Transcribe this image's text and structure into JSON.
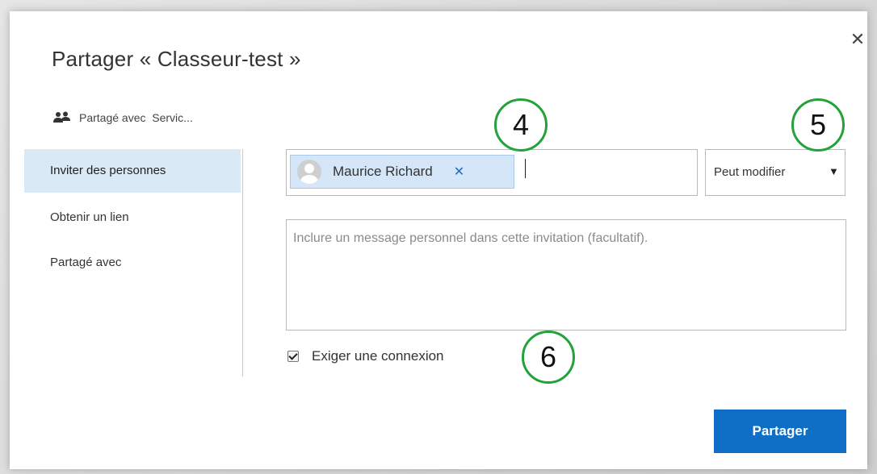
{
  "dialog": {
    "title": "Partager « Classeur-test »",
    "close_icon": "close-icon",
    "close_glyph": "✕"
  },
  "shared_with_header": {
    "icon": "people-icon",
    "label": "Partagé avec  Servic..."
  },
  "sidebar": {
    "items": [
      {
        "label": "Inviter des personnes",
        "active": true
      },
      {
        "label": "Obtenir un lien",
        "active": false
      },
      {
        "label": "Partagé avec",
        "active": false
      }
    ]
  },
  "invite": {
    "recipient": {
      "name": "Maurice Richard",
      "avatar_icon": "user-avatar-icon",
      "remove_glyph": "✕"
    }
  },
  "permission": {
    "selected": "Peut modifier",
    "arrow_glyph": "▼"
  },
  "message": {
    "placeholder": "Inclure un message personnel dans cette invitation (facultatif)."
  },
  "require_login": {
    "label": "Exiger une connexion",
    "checked": true
  },
  "share_button": {
    "label": "Partager"
  },
  "callouts": [
    {
      "label": "4"
    },
    {
      "label": "5"
    },
    {
      "label": "6"
    }
  ],
  "colors": {
    "accent": "#0f6fc6",
    "active_nav_bg": "#d9e9f6",
    "chip_bg": "#d4e6f7",
    "callout_border": "#22a33a"
  }
}
